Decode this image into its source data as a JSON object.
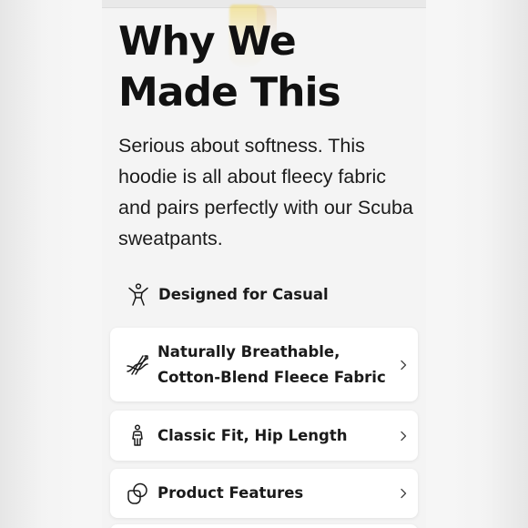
{
  "section": {
    "title": "Why We Made This",
    "description": "Serious about softness. This hoodie is all about fleecy fabric and pairs perfectly with our Scuba sweatpants."
  },
  "activity": {
    "icon": "person-stretch-icon",
    "label": "Designed for Casual"
  },
  "accordion": [
    {
      "icon": "fabric-weave-icon",
      "label": "Naturally Breathable, Cotton-Blend Fleece Fabric"
    },
    {
      "icon": "fit-figure-icon",
      "label": "Classic Fit, Hip Length"
    },
    {
      "icon": "product-features-icon",
      "label": "Product Features"
    }
  ],
  "colors": {
    "page_background": "#f4f4f4",
    "card_background": "#ffffff",
    "text": "#111111"
  }
}
